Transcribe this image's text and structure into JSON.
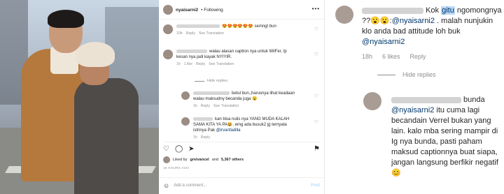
{
  "post": {
    "username": "nyaisarni2",
    "follow_status": "• Following",
    "more_glyph": "•••"
  },
  "comments": [
    {
      "text": "semngt bun",
      "emoji": "😍😍😍😍😍😍",
      "time": "10h",
      "reply_label": "Reply",
      "translation": "See Translation"
    },
    {
      "text": "walau alasan caption nya untuk WilFer, tp kesan nya jadi kayak NYIYIR.",
      "time": "1h",
      "likes": "1 like",
      "reply_label": "Reply",
      "translation": "See Translation"
    }
  ],
  "hide_replies_label": "Hide replies",
  "replies": [
    {
      "text": "betul bun,,harusnya lihat keadaan walau maksudny becanda juga",
      "emoji": "😮",
      "time": "1h",
      "reply_label": "Reply",
      "translation": "See Translation"
    },
    {
      "text_before": "kan bisa nulis nya YANG MUDA KALAH SAMA KITA YA PA😆, emg ada busuk2 jg ternyata istrinya Pak ",
      "mention": "@irvanfadilla",
      "time": "1h",
      "reply_label": "Reply"
    }
  ],
  "actions": {
    "like_icon": "♡",
    "comment_icon": "◯",
    "share_icon": "➤",
    "save_icon": "⚑"
  },
  "liked_by": {
    "prefix": "Liked by",
    "user": "greivancel",
    "middle": "and",
    "others": "5,367 others"
  },
  "post_time": "16 HOURS AGO",
  "add_comment": {
    "emoji": "☺",
    "placeholder": "Add a comment...",
    "post_label": "Post"
  },
  "zoom": {
    "c1_line1_tail": "Kok ",
    "c1_highlight": "gitu",
    "c1_line2": "ngomongnya ??😮😮:",
    "c1_mention": "@nyaisarni2",
    "c1_line3": " . malah nunjukin klo anda bad attitude loh buk ",
    "c1_mention2": "@nyaisarni2",
    "meta_time": "18h",
    "meta_likes": "6 likes",
    "meta_reply": "Reply",
    "hide_label": "Hide replies",
    "r1_tail": " bunda",
    "r1_mention": "@nyaisarni2",
    "r1_body": " itu cuma lagi becandain Verrel bukan yang lain. kalo mba sering mampir di Ig nya bunda, pasti paham maksud captionnya buat siapa, jangan langsung berfikir negatif😊"
  }
}
